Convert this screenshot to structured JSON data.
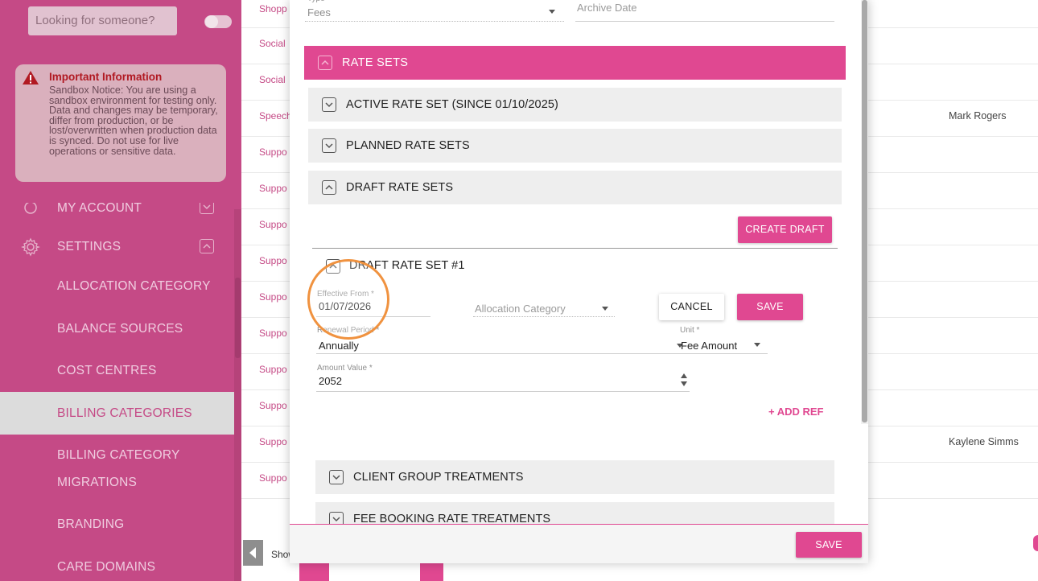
{
  "sidebar": {
    "search_placeholder": "Looking for someone?",
    "info_title": "Important Information",
    "info_text": "Sandbox Notice: You are using a sandbox environment for testing only. Data and changes may be temporary, differ from production, or be lost/overwritten when production data is synced. Do not use for live operations or sensitive data.",
    "items": [
      {
        "label": "MY ACCOUNT"
      },
      {
        "label": "SETTINGS"
      },
      {
        "label": "ALLOCATION CATEGORY"
      },
      {
        "label": "BALANCE SOURCES"
      },
      {
        "label": "COST CENTRES"
      },
      {
        "label": "BILLING CATEGORIES"
      },
      {
        "label": "BILLING CATEGORY"
      },
      {
        "label": "MIGRATIONS"
      },
      {
        "label": "BRANDING"
      },
      {
        "label": "CARE DOMAINS"
      }
    ]
  },
  "background": {
    "rows": [
      {
        "c1": "Shopp",
        "c2": ""
      },
      {
        "c1": "Social",
        "c2": ""
      },
      {
        "c1": "Social",
        "c2": ""
      },
      {
        "c1": "Speech",
        "c2": "Mark Rogers"
      },
      {
        "c1": "Suppo",
        "c2": ""
      },
      {
        "c1": "Suppo",
        "c2": ""
      },
      {
        "c1": "Suppo",
        "c2": ""
      },
      {
        "c1": "Suppo",
        "c2": ""
      },
      {
        "c1": "Suppo",
        "c2": ""
      },
      {
        "c1": "Suppo",
        "c2": ""
      },
      {
        "c1": "Suppo",
        "c2": ""
      },
      {
        "c1": "Suppo",
        "c2": ""
      },
      {
        "c1": "Suppo",
        "c2": "Kaylene Simms"
      },
      {
        "c1": "Suppo",
        "c2": ""
      }
    ],
    "shown_label": "Show"
  },
  "modal": {
    "type_value": "Fees",
    "archive_date_label": "Archive Date",
    "rate_sets_title": "RATE SETS",
    "active_rate_set": "ACTIVE RATE SET (SINCE 01/10/2025)",
    "planned_rate_sets": "PLANNED RATE SETS",
    "draft_rate_sets": "DRAFT RATE SETS",
    "create_draft": "CREATE DRAFT",
    "draft_rate_set_1": "DRAFT RATE SET #1",
    "effective_from_label": "Effective From *",
    "effective_from_value": "01/07/2026",
    "allocation_category_label": "Allocation Category",
    "cancel": "CANCEL",
    "save": "SAVE",
    "renewal_period_label": "Renewal Period *",
    "renewal_period_value": "Annually",
    "unit_label": "Unit *",
    "unit_value": "Fee Amount",
    "amount_value_label": "Amount Value *",
    "amount_value": "2052",
    "add_ref": "+ ADD REF",
    "client_group_treatments": "CLIENT GROUP TREATMENTS",
    "fee_booking_rate_treatments": "FEE BOOKING RATE TREATMENTS",
    "footer_save": "SAVE"
  }
}
